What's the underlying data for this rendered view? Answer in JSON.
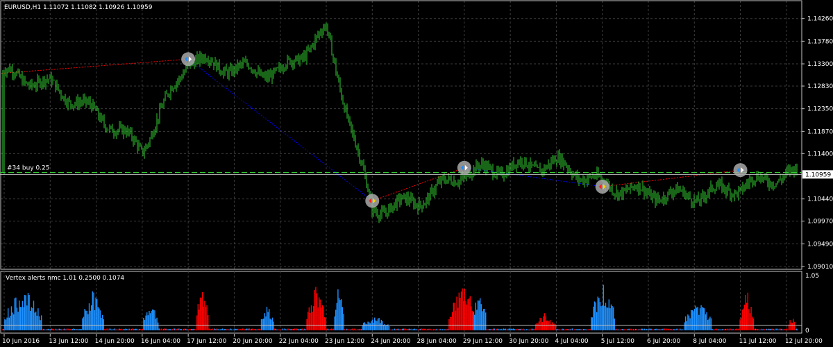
{
  "main_chart": {
    "symbol_title": "EURUSD,H1  1.11072 1.11082 1.10926 1.10959",
    "price_labels": [
      "1.14260",
      "1.13780",
      "1.13300",
      "1.12830",
      "1.12350",
      "1.11870",
      "1.11400",
      "1.10959",
      "1.10440",
      "1.09970",
      "1.09490",
      "1.09010"
    ],
    "price_ticks": [
      1.1426,
      1.1378,
      1.133,
      1.1283,
      1.1235,
      1.1187,
      1.114,
      1.1044,
      1.0997,
      1.0949,
      1.0901
    ],
    "current_price": 1.10959,
    "current_price_label": "1.10959",
    "order_label": "#34 buy 0.25",
    "order_level": 1.11,
    "ylim": [
      1.0898,
      1.1452
    ]
  },
  "chart_data": {
    "type": "candlestick",
    "title": "EURUSD,H1",
    "series": [
      {
        "name": "EURUSD,H1",
        "values": [
          {
            "x": "10 Jun 2016",
            "y": 1.131
          },
          {
            "x": "13 Jun 12:00",
            "y": 1.1285
          },
          {
            "x": "14 Jun 20:00",
            "y": 1.1225
          },
          {
            "x": "16 Jun 04:00",
            "y": 1.115
          },
          {
            "x": "17 Jun 12:00",
            "y": 1.134
          },
          {
            "x": "20 Jun 20:00",
            "y": 1.132
          },
          {
            "x": "22 Jun 04:00",
            "y": 1.131
          },
          {
            "x": "23 Jun 12:00",
            "y": 1.14
          },
          {
            "x": "24 Jun 20:00",
            "y": 1.102
          },
          {
            "x": "28 Jun 04:00",
            "y": 1.104
          },
          {
            "x": "29 Jun 12:00",
            "y": 1.11
          },
          {
            "x": "30 Jun 20:00",
            "y": 1.111
          },
          {
            "x": "4 Jul 04:00",
            "y": 1.112
          },
          {
            "x": "5 Jul 12:00",
            "y": 1.1075
          },
          {
            "x": "6 Jul 20:00",
            "y": 1.1055
          },
          {
            "x": "8 Jul 04:00",
            "y": 1.105
          },
          {
            "x": "11 Jul 12:00",
            "y": 1.107
          },
          {
            "x": "12 Jul 20:00",
            "y": 1.1096
          }
        ]
      }
    ],
    "trade_markers": [
      {
        "x": "17 Jun 12:00",
        "price": 1.134,
        "kind": "buy"
      },
      {
        "x": "24 Jun 20:00",
        "price": 1.104,
        "kind": "sell"
      },
      {
        "x": "29 Jun 12:00",
        "price": 1.111,
        "kind": "buy"
      },
      {
        "x": "5 Jul 12:00",
        "price": 1.107,
        "kind": "sell"
      },
      {
        "x": "11 Jul 12:00",
        "price": 1.1105,
        "kind": "buy"
      }
    ]
  },
  "indicator": {
    "label": "Vertex alerts nmc 1.01 0.2500 0.1074",
    "scale_labels": [
      "1.05",
      "0"
    ],
    "scale_values": [
      1.05,
      0
    ],
    "reference_level": 0.1,
    "bar_colors": {
      "up": "#1e90ff",
      "down": "#ff0000"
    }
  },
  "time_axis": {
    "labels": [
      "10 Jun 2016",
      "13 Jun 12:00",
      "14 Jun 20:00",
      "16 Jun 04:00",
      "17 Jun 12:00",
      "20 Jun 20:00",
      "22 Jun 04:00",
      "23 Jun 12:00",
      "24 Jun 20:00",
      "28 Jun 04:00",
      "29 Jun 12:00",
      "30 Jun 20:00",
      "4 Jul 04:00",
      "5 Jul 12:00",
      "6 Jul 20:00",
      "8 Jul 04:00",
      "11 Jul 12:00",
      "12 Jul 20:00"
    ]
  },
  "colors": {
    "background": "#000000",
    "candles": "#32cd32",
    "grid": "#3c3c3c",
    "order_line": "#32cd32",
    "price_line": "#c0c0c0",
    "marker_circle": "#a9a9a9",
    "trend_up": "#ff0000",
    "trend_down": "#0000ff"
  }
}
